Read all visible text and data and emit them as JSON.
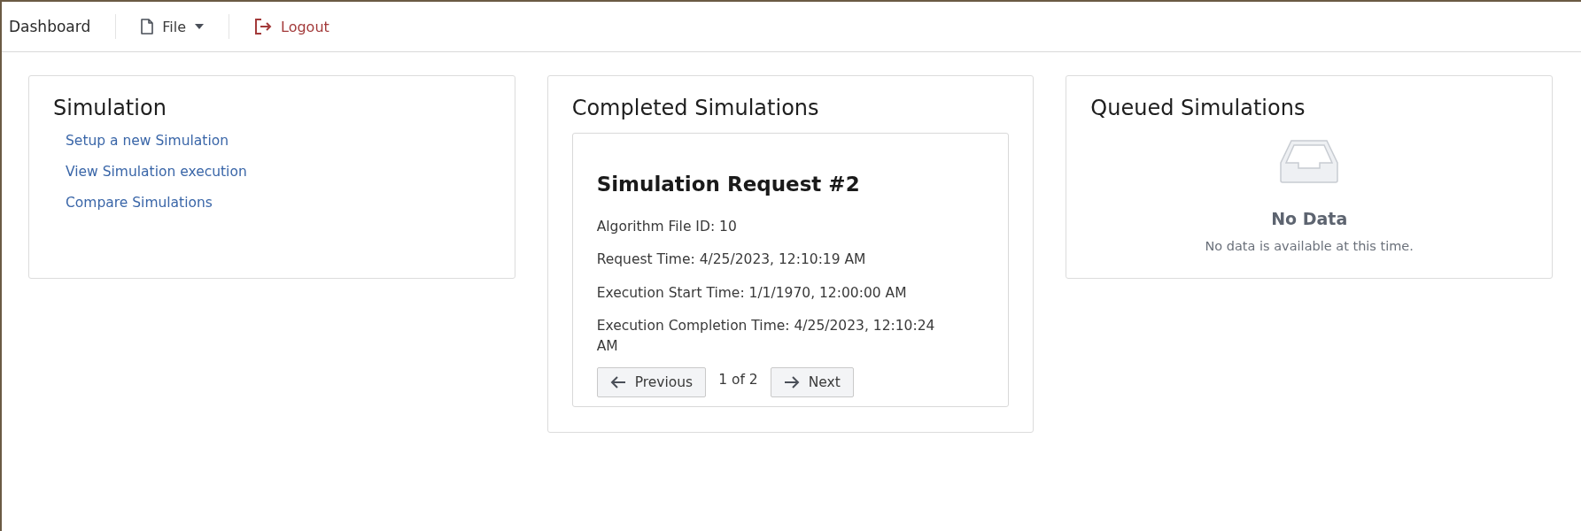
{
  "navbar": {
    "brand": "Dashboard",
    "items": [
      {
        "kind": "menu",
        "label": "File"
      },
      {
        "kind": "logout",
        "label": "Logout"
      }
    ]
  },
  "cards": [
    {
      "kind": "links",
      "title": "Simulation",
      "links": [
        "Setup a new Simulation",
        "View Simulation execution",
        "Compare Simulations"
      ]
    },
    {
      "kind": "request",
      "title": "Completed Simulations",
      "request": {
        "title": "Simulation Request #2",
        "fields": [
          "Algorithm File ID: 10",
          "Request Time: 4/25/2023, 12:10:19 AM",
          "Execution Start Time: 1/1/1970, 12:00:00 AM",
          "Execution Completion Time: 4/25/2023, 12:10:24 AM"
        ]
      },
      "pager": {
        "previous": "Previous",
        "position": "1 of 2",
        "next": "Next"
      }
    },
    {
      "kind": "empty",
      "title": "Queued Simulations",
      "empty": {
        "title": "No Data",
        "message": "No data is available at this time."
      }
    }
  ]
}
